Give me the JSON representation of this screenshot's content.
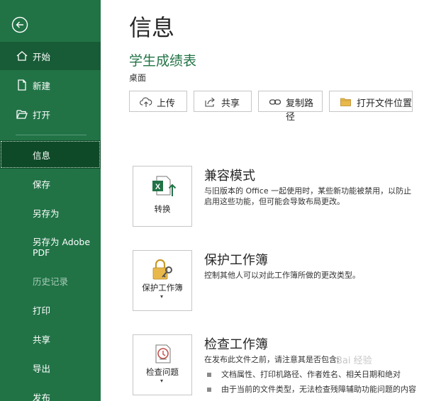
{
  "sidebar": {
    "back_icon": "back-arrow-icon",
    "items": [
      {
        "label": "开始",
        "icon": "home-icon"
      },
      {
        "label": "新建",
        "icon": "new-document-icon"
      },
      {
        "label": "打开",
        "icon": "open-folder-icon"
      },
      {
        "label": "信息"
      },
      {
        "label": "保存"
      },
      {
        "label": "另存为"
      },
      {
        "label": "另存为 Adobe PDF"
      },
      {
        "label": "历史记录"
      },
      {
        "label": "打印"
      },
      {
        "label": "共享"
      },
      {
        "label": "导出"
      },
      {
        "label": "发布"
      }
    ],
    "colors": {
      "background": "#217346",
      "active": "#0e4a27",
      "hover": "#185c37"
    }
  },
  "main": {
    "title": "信息",
    "doc_title": "学生成绩表",
    "doc_location": "桌面",
    "toolbar": [
      {
        "label": "上传",
        "icon": "upload-cloud-icon"
      },
      {
        "label": "共享",
        "icon": "share-icon"
      },
      {
        "label": "复制路径",
        "icon": "link-icon"
      },
      {
        "label": "打开文件位置",
        "icon": "folder-icon"
      }
    ],
    "sections": [
      {
        "button_label": "转换",
        "icon": "excel-convert-icon",
        "title": "兼容模式",
        "desc_lines": [
          "与旧版本的 Office 一起使用时，某些新功能被禁用，以防止",
          "启用这些功能，但可能会导致布局更改。"
        ]
      },
      {
        "button_label": "保护工作簿",
        "icon": "lock-key-icon",
        "title": "保护工作簿",
        "desc_lines": [
          "控制其他人可以对此工作簿所做的更改类型。"
        ]
      },
      {
        "button_label": "检查问题",
        "icon": "inspect-document-icon",
        "title": "检查工作簿",
        "desc_lines": [
          "在发布此文件之前，请注意其是否包含:"
        ],
        "bullets": [
          "文档属性、打印机路径、作者姓名、相关日期和绝对",
          "由于当前的文件类型，无法检查残障辅助功能问题的内容"
        ]
      }
    ],
    "watermark": "Bai 经验"
  }
}
